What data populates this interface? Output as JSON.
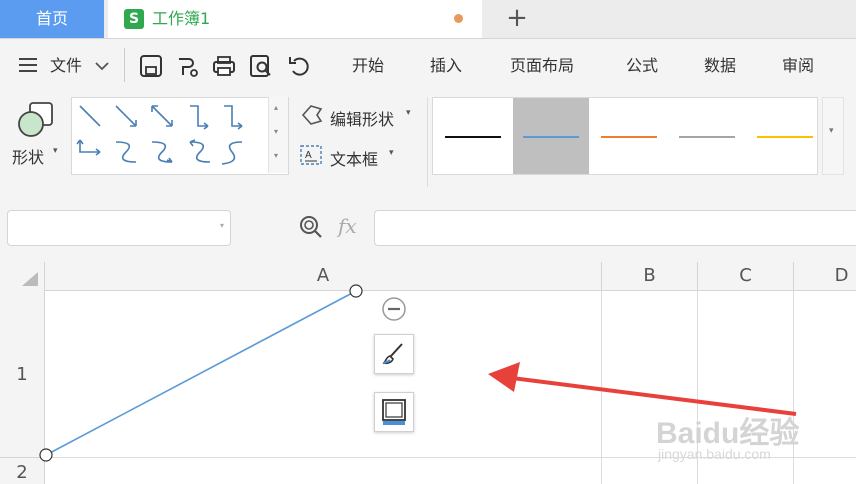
{
  "tabs": {
    "home": "首页",
    "workbook": "工作簿1",
    "workbook_icon": "S",
    "add": "+"
  },
  "menu": {
    "hamburger_label": "文件",
    "items": [
      "开始",
      "插入",
      "页面布局",
      "公式",
      "数据",
      "审阅"
    ]
  },
  "ribbon": {
    "shape_label": "形状",
    "edit_shape": "编辑形状",
    "text_box": "文本框",
    "line_colors": [
      "#111111",
      "#5b9bd5",
      "#ed7d31",
      "#a5a5a5",
      "#ffc000"
    ],
    "selected_style_index": 1
  },
  "formula_bar": {
    "fx": "fx",
    "name_box_value": "",
    "formula_value": ""
  },
  "grid": {
    "columns": [
      "A",
      "B",
      "C",
      "D"
    ],
    "rows": [
      "1",
      "2"
    ]
  },
  "watermark": {
    "brand": "Baidu经验",
    "url": "jingyan.baidu.com"
  },
  "colors": {
    "accent": "#5b9cf0",
    "sheet_green": "#2fa84f",
    "line_blue": "#5b9bd5",
    "arrow_red": "#e8413c"
  }
}
